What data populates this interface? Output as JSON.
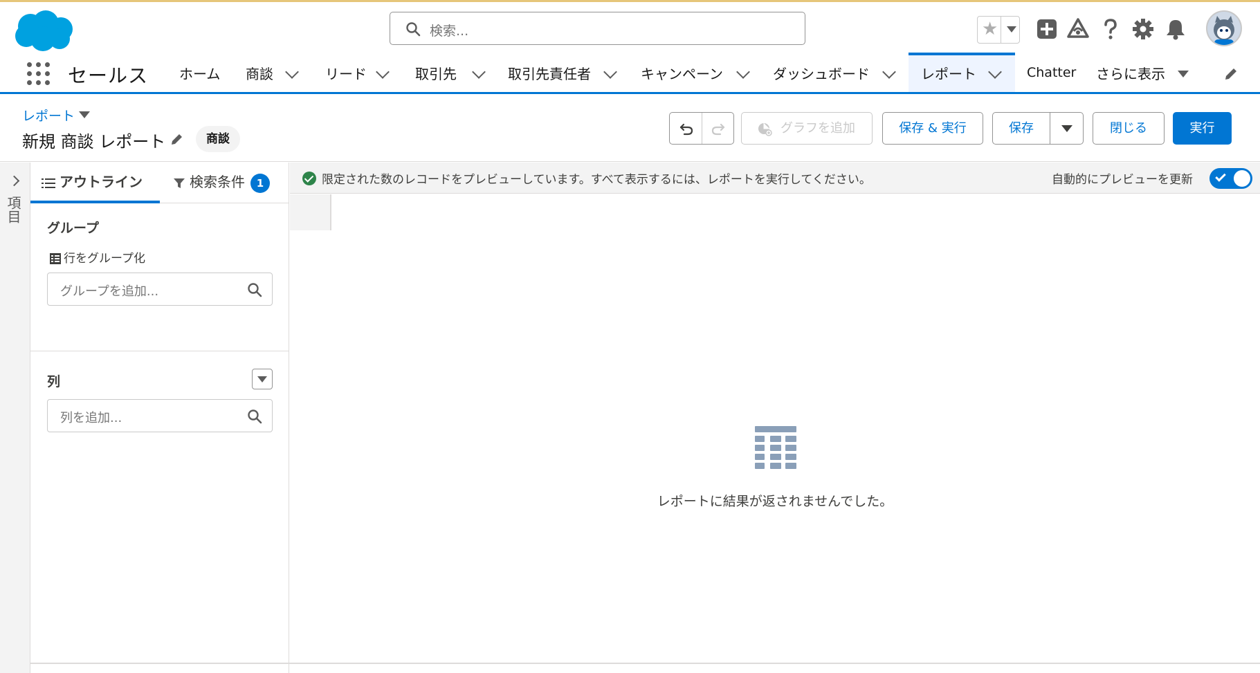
{
  "header": {
    "search_placeholder": "検索...",
    "icons": [
      "star-icon",
      "plus-icon",
      "trailhead-icon",
      "help-icon",
      "gear-icon",
      "bell-icon"
    ]
  },
  "nav": {
    "app_name": "セールス",
    "items": [
      {
        "label": "ホーム",
        "has_menu": false
      },
      {
        "label": "商談",
        "has_menu": true
      },
      {
        "label": "リード",
        "has_menu": true
      },
      {
        "label": "取引先",
        "has_menu": true
      },
      {
        "label": "取引先責任者",
        "has_menu": true
      },
      {
        "label": "キャンペーン",
        "has_menu": true
      },
      {
        "label": "ダッシュボード",
        "has_menu": true
      },
      {
        "label": "レポート",
        "has_menu": true,
        "active": true
      },
      {
        "label": "Chatter",
        "has_menu": false
      },
      {
        "label": "さらに表示",
        "has_menu": true
      }
    ]
  },
  "report_header": {
    "breadcrumb": "レポート",
    "title": "新規 商談 レポート",
    "report_type_pill": "商談",
    "buttons": {
      "add_chart": "グラフを追加",
      "save_and_run": "保存 & 実行",
      "save": "保存",
      "close": "閉じる",
      "run": "実行"
    }
  },
  "fields_strip": {
    "label": "項目"
  },
  "side_panel": {
    "tabs": {
      "outline": "アウトライン",
      "filters": "検索条件",
      "filters_count": "1"
    },
    "groups": {
      "title": "グループ",
      "group_rows_label": "行をグループ化",
      "add_group_placeholder": "グループを追加..."
    },
    "columns": {
      "title": "列",
      "add_column_placeholder": "列を追加..."
    }
  },
  "preview": {
    "message": "限定された数のレコードをプレビューしています。すべて表示するには、レポートを実行してください。",
    "auto_preview_label": "自動的にプレビューを更新",
    "auto_preview_on": true,
    "empty_message": "レポートに結果が返されませんでした。"
  },
  "colors": {
    "brand": "#0176d3",
    "success": "#2e844a",
    "logo": "#00a1e0"
  }
}
